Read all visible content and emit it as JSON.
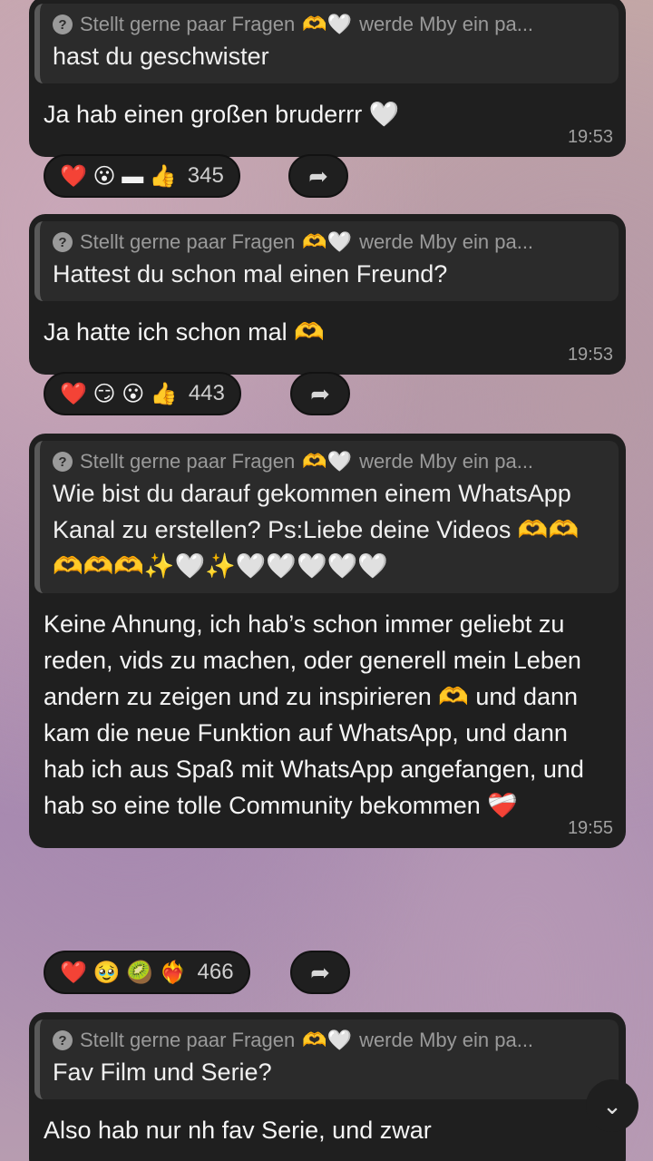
{
  "quote_header": {
    "author": "Stellt gerne paar Fragen",
    "suffix": "werde Mby ein pa..."
  },
  "messages": [
    {
      "question": "hast du geschwister",
      "reply": "Ja hab einen großen bruderrr 🤍",
      "time": "19:53",
      "reactions": "❤️ 😮 ▬ 👍",
      "count": "345"
    },
    {
      "question": "Hattest du schon mal einen Freund?",
      "reply": "Ja hatte ich schon mal 🫶",
      "time": "19:53",
      "reactions": "❤️ 😏 😮 👍",
      "count": "443"
    },
    {
      "question": "Wie bist du darauf gekommen einem WhatsApp Kanal zu erstellen? Ps:Liebe deine Videos 🫶🫶🫶🫶🫶✨🤍✨🤍🤍🤍🤍🤍",
      "reply": "Keine Ahnung, ich hab’s schon immer geliebt zu reden, vids zu machen, oder generell mein Leben andern zu zeigen und zu inspirieren 🫶 und dann kam die neue Funktion auf WhatsApp, und dann hab ich aus Spaß mit WhatsApp angefangen, und hab so eine tolle Community bekommen ❤️‍🩹",
      "time": "19:55",
      "reactions": "❤️ 🥹 🥝 ❤️‍🔥",
      "count": "466"
    },
    {
      "question": "Fav Film und Serie?",
      "reply": "Also hab nur nh fav Serie, und zwar"
    }
  ],
  "icons": {
    "forward": "forward-arrow-icon",
    "scroll": "chevron-down-icon"
  }
}
